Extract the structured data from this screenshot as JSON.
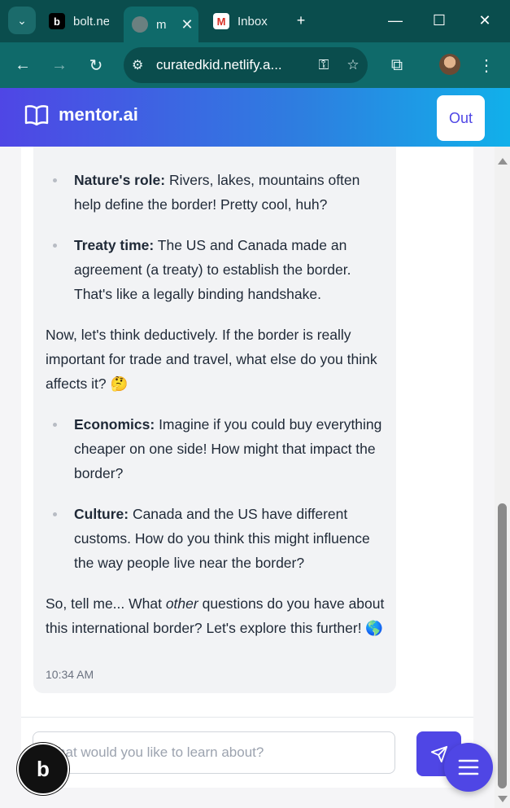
{
  "browser": {
    "tabs": [
      {
        "label": "bolt.ne",
        "icon": "bolt-favicon"
      },
      {
        "label": "m",
        "icon": "globe-favicon",
        "active": true
      },
      {
        "label": "Inbox",
        "icon": "gmail-favicon",
        "badge": "0"
      }
    ],
    "url": "curatedkid.netlify.a..."
  },
  "app": {
    "brand": "mentor.ai",
    "out_button": "Out"
  },
  "message": {
    "bullets_1": [
      {
        "bold": "Nature's role:",
        "text": " Rivers, lakes, mountains often help define the border! Pretty cool, huh?"
      },
      {
        "bold": "Treaty time:",
        "text": " The US and Canada made an agreement (a treaty) to establish the border. That's like a legally binding handshake."
      }
    ],
    "para_1": "Now, let's think deductively. If the border is really important for trade and travel, what else do you think affects it? 🤔",
    "bullets_2": [
      {
        "bold": "Economics:",
        "text": " Imagine if you could buy everything cheaper on one side! How might that impact the border?"
      },
      {
        "bold": "Culture:",
        "text": " Canada and the US have different customs. How do you think this might influence the way people live near the border?"
      }
    ],
    "para_2_before": "So, tell me... What ",
    "para_2_em": "other",
    "para_2_after": " questions do you have about this international border? Let's explore this further! 🌎",
    "time": "10:34 AM"
  },
  "input": {
    "placeholder": "What would you like to learn about?"
  },
  "badge": {
    "label": "b"
  },
  "colors": {
    "accent": "#4f46e5",
    "header_start": "#4f46e5",
    "header_end": "#11b0ea",
    "browser_frame": "#0a4d4d"
  }
}
